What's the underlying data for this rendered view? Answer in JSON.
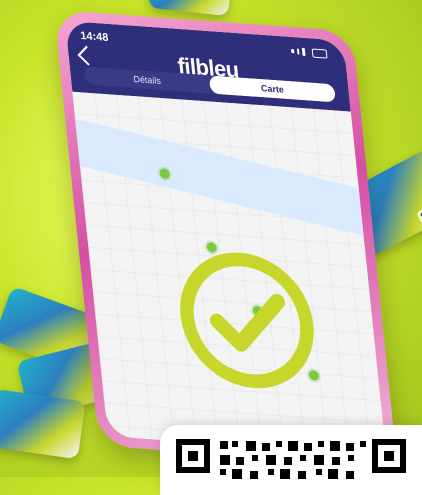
{
  "status": {
    "time": "14:48"
  },
  "app": {
    "brand": "filbleu"
  },
  "tabs": [
    {
      "label": "Détails",
      "active": false
    },
    {
      "label": "Carte",
      "active": true
    }
  ],
  "cards": {
    "label": "filbleu"
  },
  "colors": {
    "background": "#c9e52a",
    "header": "#2f2e7a",
    "accent": "#c7d62b",
    "phone": "#d44fa3"
  }
}
